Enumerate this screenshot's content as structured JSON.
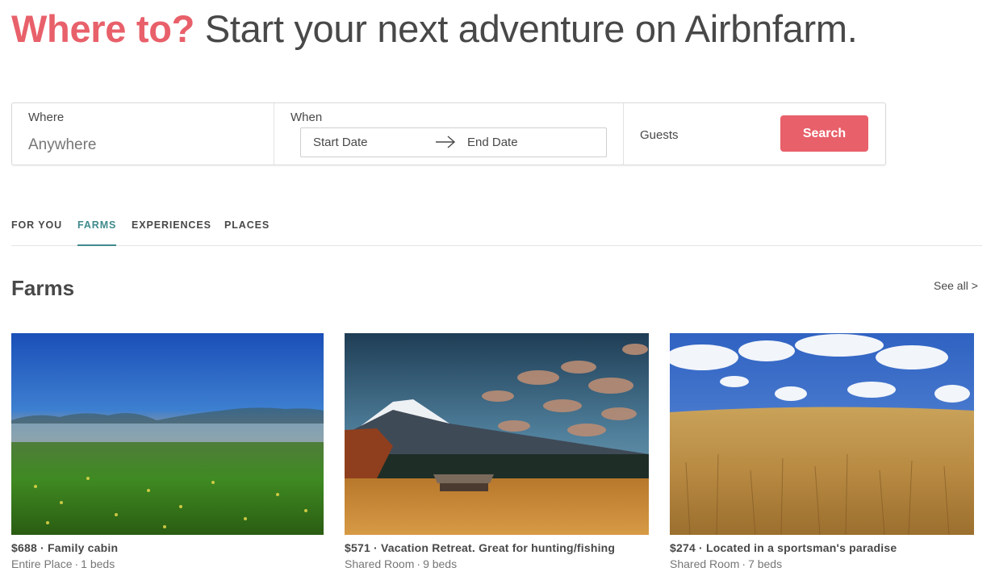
{
  "hero": {
    "accent": "Where to?",
    "rest": "Start your next adventure on Airbnfarm."
  },
  "search": {
    "where_label": "Where",
    "where_placeholder": "Anywhere",
    "when_label": "When",
    "start_date": "Start Date",
    "end_date": "End Date",
    "guests_label": "Guests",
    "button_label": "Search"
  },
  "tabs": [
    {
      "label": "FOR YOU",
      "active": false
    },
    {
      "label": "FARMS",
      "active": true
    },
    {
      "label": "EXPERIENCES",
      "active": false
    },
    {
      "label": "PLACES",
      "active": false
    }
  ],
  "section": {
    "title": "Farms",
    "see_all": "See all >"
  },
  "listings": [
    {
      "price": "$688",
      "title": "Family cabin",
      "room_type": "Entire Place",
      "beds": "1 beds",
      "image": "misty meadow at sunrise"
    },
    {
      "price": "$571",
      "title": "Vacation Retreat. Great for hunting/fishing",
      "room_type": "Shared Room",
      "beds": "9 beds",
      "image": "barn below snowy mountain"
    },
    {
      "price": "$274",
      "title": "Located in a sportsman's paradise",
      "room_type": "Shared Room",
      "beds": "7 beds",
      "image": "wheat field under cloudy sky"
    }
  ],
  "colors": {
    "accent": "#E8606A",
    "tab_active": "#3F8A8C",
    "text": "#484848",
    "muted": "#767676"
  }
}
